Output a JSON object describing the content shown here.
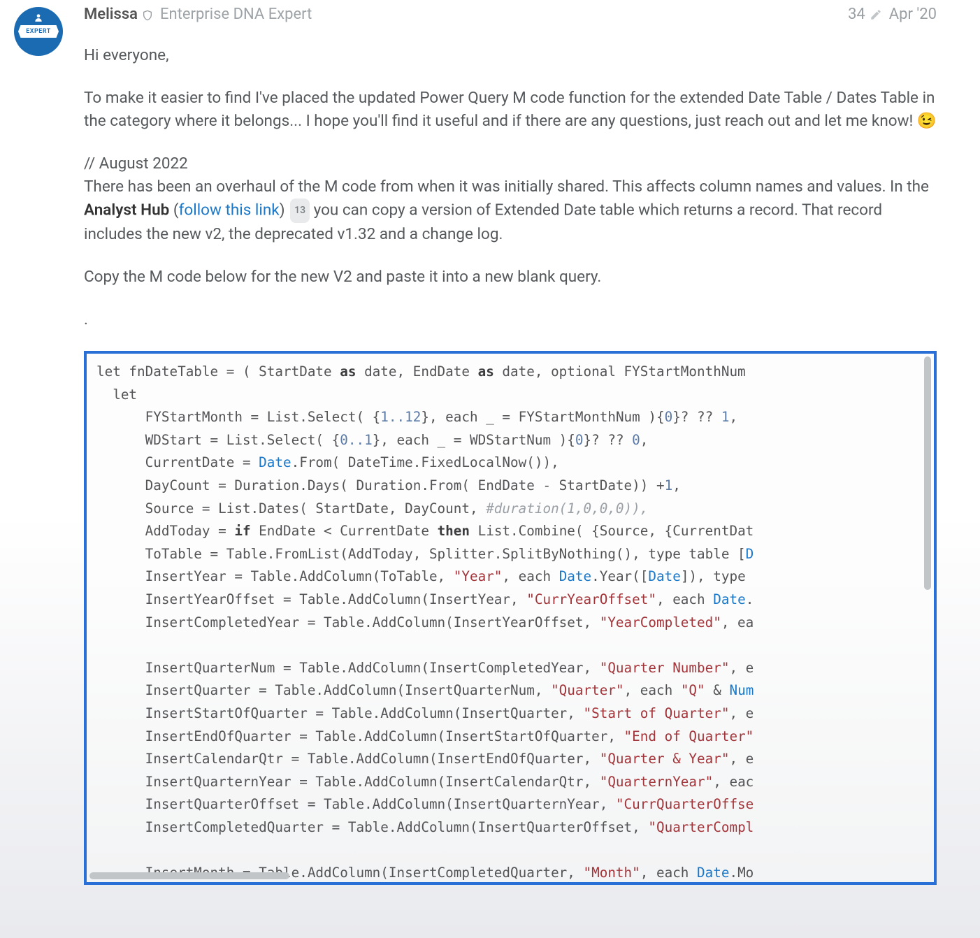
{
  "author": {
    "name": "Melissa",
    "title": "Enterprise DNA Expert",
    "avatar_label": "EXPERT"
  },
  "meta": {
    "edit_count": "34",
    "date": "Apr '20"
  },
  "body": {
    "greeting": "Hi everyone,",
    "para1": "To make it easier to find I've placed the updated Power Query M code function for the extended Date Table / Dates Table in the category where it belongs... I hope you'll find it useful and if there are any questions, just reach out and let me know! 😉",
    "update_header": "// August 2022",
    "update_p_a": "There has been an overhaul of the M code from when it was initially shared. This affects column names and values. In the ",
    "update_bold": "Analyst Hub",
    "update_p_b": " (",
    "link_text": "follow this link",
    "link_count": "13",
    "update_p_c": ") ",
    "update_p_d": " you can copy a version of Extended Date table which returns a record. That record includes the new v2, the deprecated v1.32 and a change log.",
    "para3": "Copy the M code below for the new V2 and paste it into a new blank query.",
    "dot": "."
  },
  "code": {
    "l01_a": "let fnDateTable = ( StartDate ",
    "l01_kw1": "as",
    "l01_b": " date, EndDate ",
    "l01_kw2": "as",
    "l01_c": " date, optional FYStartMonthNum",
    "l02": "  let",
    "l03_a": "      FYStartMonth = List.Select( {",
    "l03_n1": "1..12",
    "l03_b": "}, each _ = FYStartMonthNum ){",
    "l03_n2": "0",
    "l03_c": "}? ?? ",
    "l03_n3": "1",
    "l03_d": ",",
    "l04_a": "      WDStart = List.Select( {",
    "l04_n1": "0..1",
    "l04_b": "}, each _ = WDStartNum ){",
    "l04_n2": "0",
    "l04_c": "}? ?? ",
    "l04_n3": "0",
    "l04_d": ",",
    "l05_a": "      CurrentDate = ",
    "l05_blue": "Date",
    "l05_b": ".From( DateTime.FixedLocalNow()),",
    "l06_a": "      DayCount = Duration.Days( Duration.From( EndDate - StartDate)) +",
    "l06_n": "1",
    "l06_b": ",",
    "l07_a": "      Source = List.Dates( StartDate, DayCount, ",
    "l07_c": "#duration(1,0,0,0)),",
    "l08_a": "      AddToday = ",
    "l08_kw1": "if",
    "l08_b": " EndDate < CurrentDate ",
    "l08_kw2": "then",
    "l08_c": " List.Combine( {Source, {CurrentDat",
    "l09_a": "      ToTable = Table.FromList(AddToday, Splitter.SplitByNothing(), type table [",
    "l09_blue": "D",
    "l10_a": "      InsertYear = Table.AddColumn(ToTable, ",
    "l10_s": "\"Year\"",
    "l10_b": ", each ",
    "l10_blue1": "Date",
    "l10_c": ".Year([",
    "l10_blue2": "Date",
    "l10_d": "]), type ",
    "l11_a": "      InsertYearOffset = Table.AddColumn(InsertYear, ",
    "l11_s": "\"CurrYearOffset\"",
    "l11_b": ", each ",
    "l11_blue": "Date",
    "l11_c": ".",
    "l12_a": "      InsertCompletedYear = Table.AddColumn(InsertYearOffset, ",
    "l12_s": "\"YearCompleted\"",
    "l12_b": ", ea",
    "blank1": "",
    "l13_a": "      InsertQuarterNum = Table.AddColumn(InsertCompletedYear, ",
    "l13_s": "\"Quarter Number\"",
    "l13_b": ", e",
    "l14_a": "      InsertQuarter = Table.AddColumn(InsertQuarterNum, ",
    "l14_s1": "\"Quarter\"",
    "l14_b": ", each ",
    "l14_s2": "\"Q\"",
    "l14_c": " & ",
    "l14_blue": "Num",
    "l15_a": "      InsertStartOfQuarter = Table.AddColumn(InsertQuarter, ",
    "l15_s": "\"Start of Quarter\"",
    "l15_b": ", e",
    "l16_a": "      InsertEndOfQuarter = Table.AddColumn(InsertStartOfQuarter, ",
    "l16_s": "\"End of Quarter\"",
    "l17_a": "      InsertCalendarQtr = Table.AddColumn(InsertEndOfQuarter, ",
    "l17_s": "\"Quarter & Year\"",
    "l17_b": ", e",
    "l18_a": "      InsertQuarternYear = Table.AddColumn(InsertCalendarQtr, ",
    "l18_s": "\"QuarternYear\"",
    "l18_b": ", eac",
    "l19_a": "      InsertQuarterOffset = Table.AddColumn(InsertQuarternYear, ",
    "l19_s": "\"CurrQuarterOffse",
    "l20_a": "      InsertCompletedQuarter = Table.AddColumn(InsertQuarterOffset, ",
    "l20_s": "\"QuarterCompl",
    "blank2": "",
    "l21_a": "      InsertMonth = Table.AddColumn(InsertCompletedQuarter, ",
    "l21_s": "\"Month\"",
    "l21_b": ", each ",
    "l21_blue": "Date",
    "l21_c": ".Mo"
  }
}
